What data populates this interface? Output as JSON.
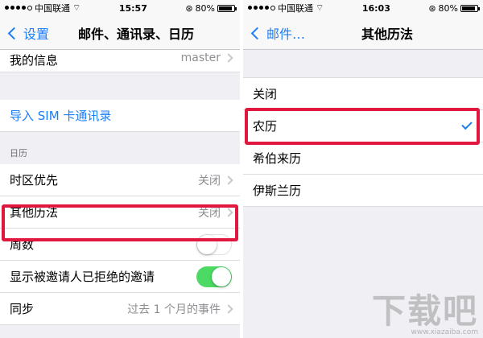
{
  "left_screen": {
    "status": {
      "carrier": "中国联通",
      "time": "15:57",
      "battery": "80%",
      "battery_level": 0.8
    },
    "nav": {
      "back": "设置",
      "title": "邮件、通讯录、日历"
    },
    "rows": {
      "my_info": {
        "label": "我的信息",
        "value": "master"
      },
      "import_sim": {
        "label": "导入 SIM 卡通讯录"
      },
      "calendar_header": "日历",
      "timezone": {
        "label": "时区优先",
        "value": "关闭"
      },
      "other_calendars": {
        "label": "其他历法",
        "value": "关闭"
      },
      "week_numbers": {
        "label": "周数",
        "toggle": "off"
      },
      "show_declined": {
        "label": "显示被邀请人已拒绝的邀请",
        "toggle": "on"
      },
      "sync": {
        "label": "同步",
        "value": "过去 1 个月的事件"
      }
    }
  },
  "right_screen": {
    "status": {
      "carrier": "中国联通",
      "time": "16:03",
      "battery": "80%",
      "battery_level": 0.8
    },
    "nav": {
      "back": "邮件…",
      "title": "其他历法"
    },
    "options": [
      {
        "label": "关闭",
        "selected": false
      },
      {
        "label": "农历",
        "selected": true
      },
      {
        "label": "希伯来历",
        "selected": false
      },
      {
        "label": "伊斯兰历",
        "selected": false
      }
    ]
  },
  "watermark": {
    "text": "下载吧",
    "url": "www.xiazaiba.com"
  },
  "colors": {
    "accent": "#1c7ef5",
    "highlight": "#e0173f",
    "toggle_on": "#4cd964"
  }
}
